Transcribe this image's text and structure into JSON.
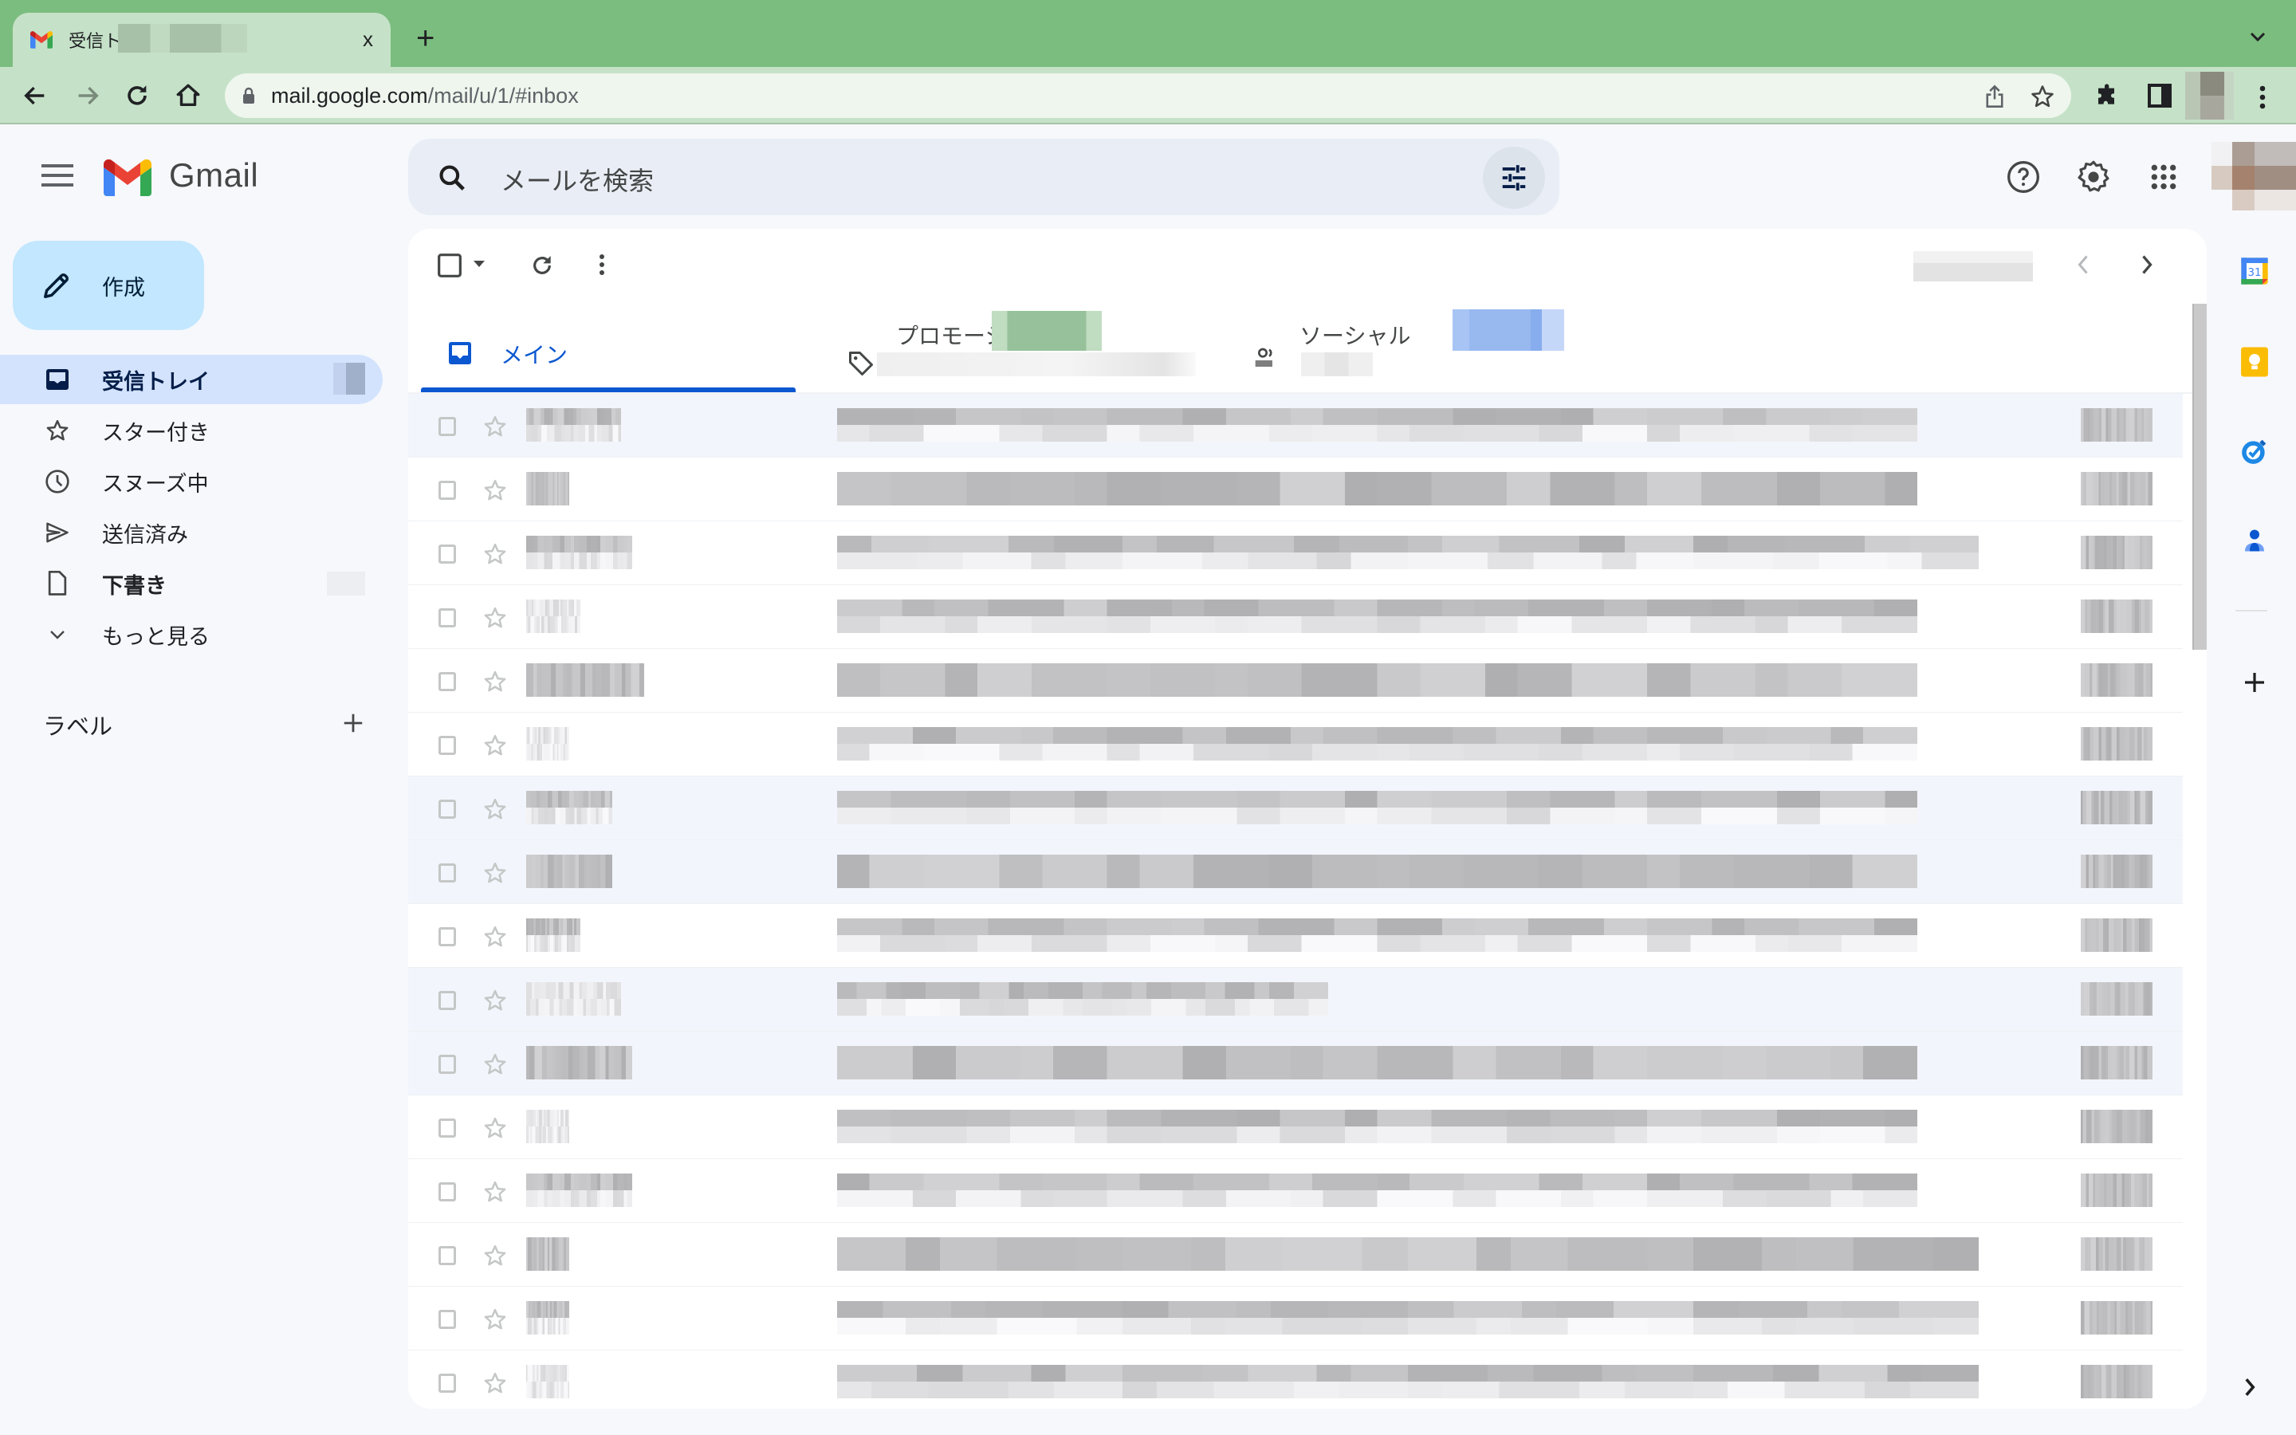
{
  "browser": {
    "tab_title": "受信トレイ",
    "close_label": "x",
    "new_tab_label": "+",
    "url_host": "mail.google.com",
    "url_path": "/mail/u/1/#inbox",
    "theme_color": "#7bbd7e",
    "toolbar_color": "#c5e2c8"
  },
  "header": {
    "app_name": "Gmail",
    "search_placeholder": "メールを検索",
    "icons": [
      "support-icon",
      "settings-icon",
      "apps-icon",
      "account-avatar"
    ]
  },
  "sidebar": {
    "compose_label": "作成",
    "items": [
      {
        "label": "受信トレイ",
        "icon": "inbox-icon",
        "active": true,
        "bold": true
      },
      {
        "label": "スター付き",
        "icon": "star-icon",
        "active": false,
        "bold": false
      },
      {
        "label": "スヌーズ中",
        "icon": "clock-icon",
        "active": false,
        "bold": false
      },
      {
        "label": "送信済み",
        "icon": "send-icon",
        "active": false,
        "bold": false
      },
      {
        "label": "下書き",
        "icon": "draft-icon",
        "active": false,
        "bold": true
      },
      {
        "label": "もっと見る",
        "icon": "chevron-down-icon",
        "active": false,
        "bold": false
      }
    ],
    "labels_heading": "ラベル",
    "labels_add": "+"
  },
  "main": {
    "category_tabs": [
      {
        "label": "メイン",
        "icon": "inbox-icon",
        "active": true
      },
      {
        "label": "プロモーション",
        "icon": "tag-icon",
        "active": false
      },
      {
        "label": "ソーシャル",
        "icon": "people-icon",
        "active": false
      }
    ],
    "accent_color": "#0b57d0",
    "emails": [
      {
        "read": true,
        "sender_width": 0.33,
        "subject_width": 0.88,
        "two_line": true
      },
      {
        "read": false,
        "sender_width": 0.15,
        "subject_width": 0.88,
        "two_line": false
      },
      {
        "read": false,
        "sender_width": 0.37,
        "subject_width": 0.93,
        "two_line": true
      },
      {
        "read": false,
        "sender_width": 0.19,
        "subject_width": 0.88,
        "two_line": true
      },
      {
        "read": false,
        "sender_width": 0.41,
        "subject_width": 0.88,
        "two_line": false
      },
      {
        "read": false,
        "sender_width": 0.15,
        "subject_width": 0.88,
        "two_line": true
      },
      {
        "read": true,
        "sender_width": 0.3,
        "subject_width": 0.88,
        "two_line": true
      },
      {
        "read": true,
        "sender_width": 0.3,
        "subject_width": 0.88,
        "two_line": false
      },
      {
        "read": false,
        "sender_width": 0.19,
        "subject_width": 0.88,
        "two_line": true
      },
      {
        "read": true,
        "sender_width": 0.33,
        "subject_width": 0.4,
        "two_line": true
      },
      {
        "read": true,
        "sender_width": 0.37,
        "subject_width": 0.88,
        "two_line": false
      },
      {
        "read": false,
        "sender_width": 0.15,
        "subject_width": 0.88,
        "two_line": true
      },
      {
        "read": false,
        "sender_width": 0.37,
        "subject_width": 0.88,
        "two_line": true
      },
      {
        "read": false,
        "sender_width": 0.15,
        "subject_width": 0.93,
        "two_line": false
      },
      {
        "read": false,
        "sender_width": 0.15,
        "subject_width": 0.93,
        "two_line": true
      },
      {
        "read": false,
        "sender_width": 0.15,
        "subject_width": 0.93,
        "two_line": true
      }
    ]
  },
  "right_rail": {
    "apps": [
      "calendar-icon",
      "keep-icon",
      "tasks-icon",
      "contacts-icon"
    ],
    "add_label": "+"
  }
}
